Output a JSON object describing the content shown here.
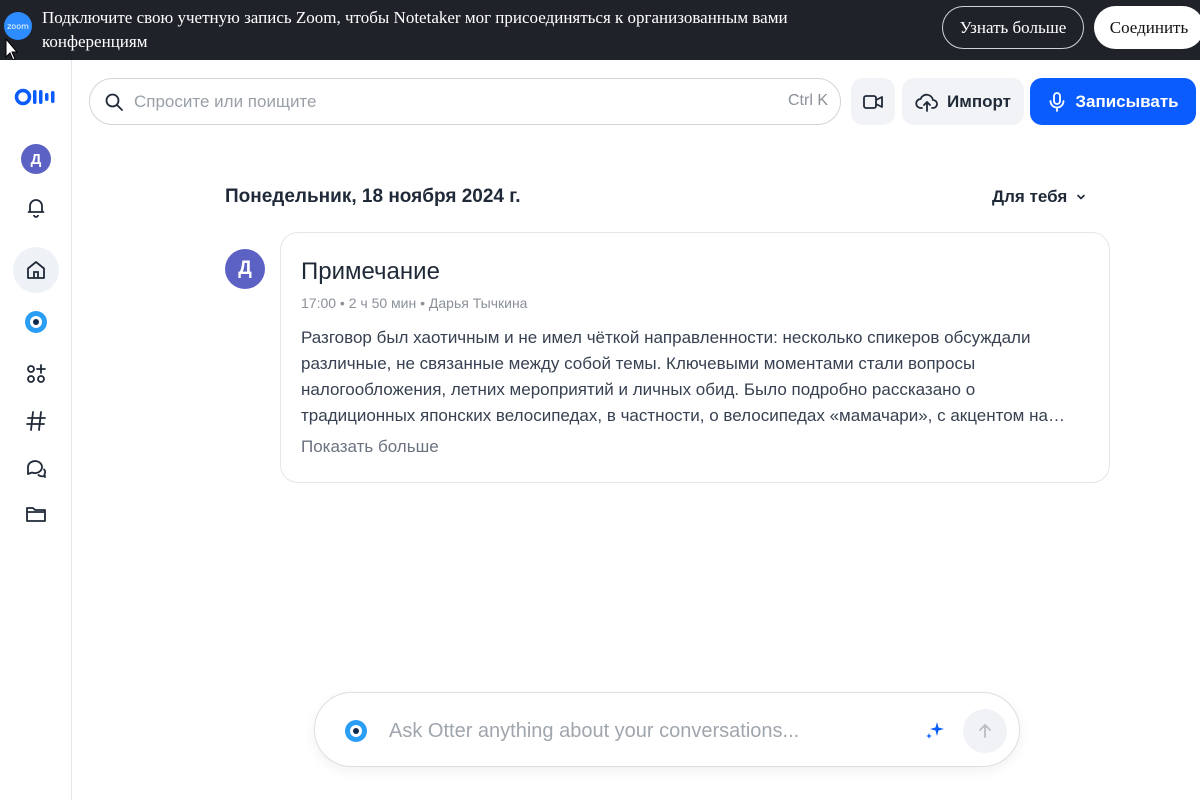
{
  "banner": {
    "logo_text": "zoom",
    "message": "Подключите свою учетную запись Zoom, чтобы Notetaker мог присоединяться к организованным вами конференциям",
    "learn_more_label": "Узнать больше",
    "connect_label": "Соединить"
  },
  "sidebar": {
    "avatar_initial": "Д",
    "items": [
      {
        "icon": "bell-icon"
      },
      {
        "icon": "home-icon",
        "active": true
      },
      {
        "icon": "otter-chat-icon"
      },
      {
        "icon": "apps-add-icon"
      },
      {
        "icon": "hashtag-icon"
      },
      {
        "icon": "conversations-icon"
      },
      {
        "icon": "folder-icon"
      }
    ]
  },
  "topbar": {
    "search_placeholder": "Спросите или поищите",
    "search_shortcut": "Ctrl K",
    "import_label": "Импорт",
    "record_label": "Записывать",
    "accent_color": "#0b5cff"
  },
  "main": {
    "date_heading": "Понедельник, 18 ноября 2024 г.",
    "filter_label": "Для тебя",
    "conversation": {
      "avatar_initial": "Д",
      "title": "Примечание",
      "meta": "17:00 • 2 ч 50 мин • Дарья Тычкина",
      "summary": "Разговор был хаотичным и не имел чёткой направленности: несколько спикеров обсуждали различные, не связанные между собой темы. Ключевыми моментами стали вопросы налогообложения, летних мероприятий и личных обид. Было подробно рассказано о традиционных японских велосипедах, в частности, о велосипедах «мамачари», с акцентом на…",
      "show_more_label": "Показать больше"
    }
  },
  "ask": {
    "placeholder": "Ask Otter anything about your conversations..."
  }
}
